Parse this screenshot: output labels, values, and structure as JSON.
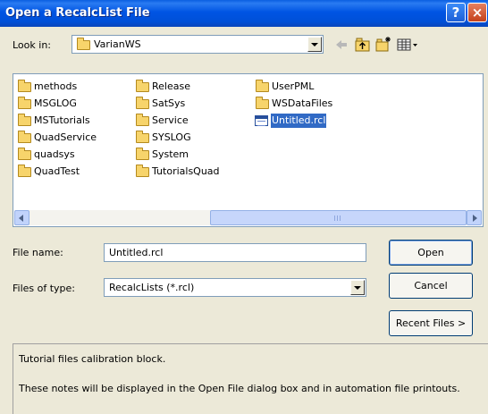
{
  "window": {
    "title": "Open a RecalcList File",
    "help_glyph": "?",
    "close_glyph": "×"
  },
  "lookin": {
    "label": "Look in:",
    "value": "VarianWS",
    "tools": [
      "back-arrow-icon",
      "up-one-level-icon",
      "new-folder-icon",
      "view-menu-icon"
    ]
  },
  "files": {
    "columns": [
      [
        {
          "name": "methods",
          "type": "folder"
        },
        {
          "name": "MSGLOG",
          "type": "folder"
        },
        {
          "name": "MSTutorials",
          "type": "folder"
        },
        {
          "name": "QuadService",
          "type": "folder"
        },
        {
          "name": "quadsys",
          "type": "folder"
        },
        {
          "name": "QuadTest",
          "type": "folder"
        }
      ],
      [
        {
          "name": "Release",
          "type": "folder"
        },
        {
          "name": "SatSys",
          "type": "folder"
        },
        {
          "name": "Service",
          "type": "folder"
        },
        {
          "name": "SYSLOG",
          "type": "folder"
        },
        {
          "name": "System",
          "type": "folder"
        },
        {
          "name": "TutorialsQuad",
          "type": "folder"
        }
      ],
      [
        {
          "name": "UserPML",
          "type": "folder"
        },
        {
          "name": "WSDataFiles",
          "type": "folder"
        },
        {
          "name": "Untitled.rcl",
          "type": "file",
          "selected": true
        }
      ]
    ]
  },
  "form": {
    "filename_label": "File name:",
    "filename_value": "Untitled.rcl",
    "filetype_label": "Files of type:",
    "filetype_value": "RecalcLists (*.rcl)"
  },
  "buttons": {
    "open": "Open",
    "cancel": "Cancel",
    "recent": "Recent Files >"
  },
  "notes": {
    "line1": "Tutorial files calibration block.",
    "line2": "These notes will be displayed in the Open File dialog box and in automation file printouts."
  },
  "colors": {
    "titlebar": "#0054e3",
    "dialog_bg": "#ece9d8",
    "selection": "#316ac5"
  }
}
